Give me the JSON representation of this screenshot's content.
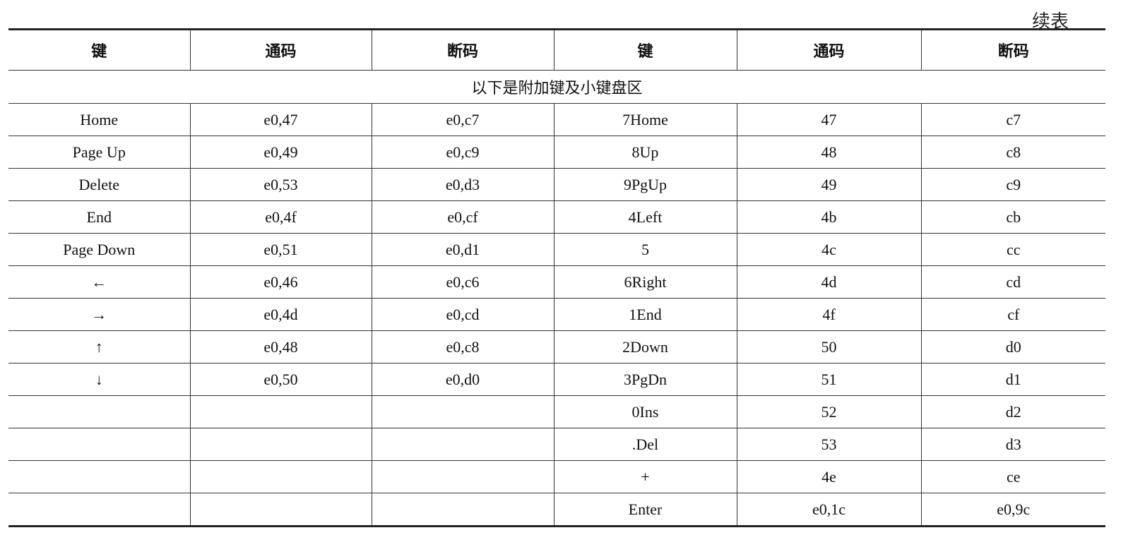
{
  "caption": "续表",
  "headers": [
    "键",
    "通码",
    "断码",
    "键",
    "通码",
    "断码"
  ],
  "section_label": "以下是附加键及小键盘区",
  "rows": [
    [
      "Home",
      "e0,47",
      "e0,c7",
      "7Home",
      "47",
      "c7"
    ],
    [
      "Page Up",
      "e0,49",
      "e0,c9",
      "8Up",
      "48",
      "c8"
    ],
    [
      "Delete",
      "e0,53",
      "e0,d3",
      "9PgUp",
      "49",
      "c9"
    ],
    [
      "End",
      "e0,4f",
      "e0,cf",
      "4Left",
      "4b",
      "cb"
    ],
    [
      "Page Down",
      "e0,51",
      "e0,d1",
      "5",
      "4c",
      "cc"
    ],
    [
      "←",
      "e0,46",
      "e0,c6",
      "6Right",
      "4d",
      "cd"
    ],
    [
      "→",
      "e0,4d",
      "e0,cd",
      "1End",
      "4f",
      "cf"
    ],
    [
      "↑",
      "e0,48",
      "e0,c8",
      "2Down",
      "50",
      "d0"
    ],
    [
      "↓",
      "e0,50",
      "e0,d0",
      "3PgDn",
      "51",
      "d1"
    ],
    [
      "",
      "",
      "",
      "0Ins",
      "52",
      "d2"
    ],
    [
      "",
      "",
      "",
      ".Del",
      "53",
      "d3"
    ],
    [
      "",
      "",
      "",
      "+",
      "4e",
      "ce"
    ],
    [
      "",
      "",
      "",
      "Enter",
      "e0,1c",
      "e0,9c"
    ]
  ]
}
